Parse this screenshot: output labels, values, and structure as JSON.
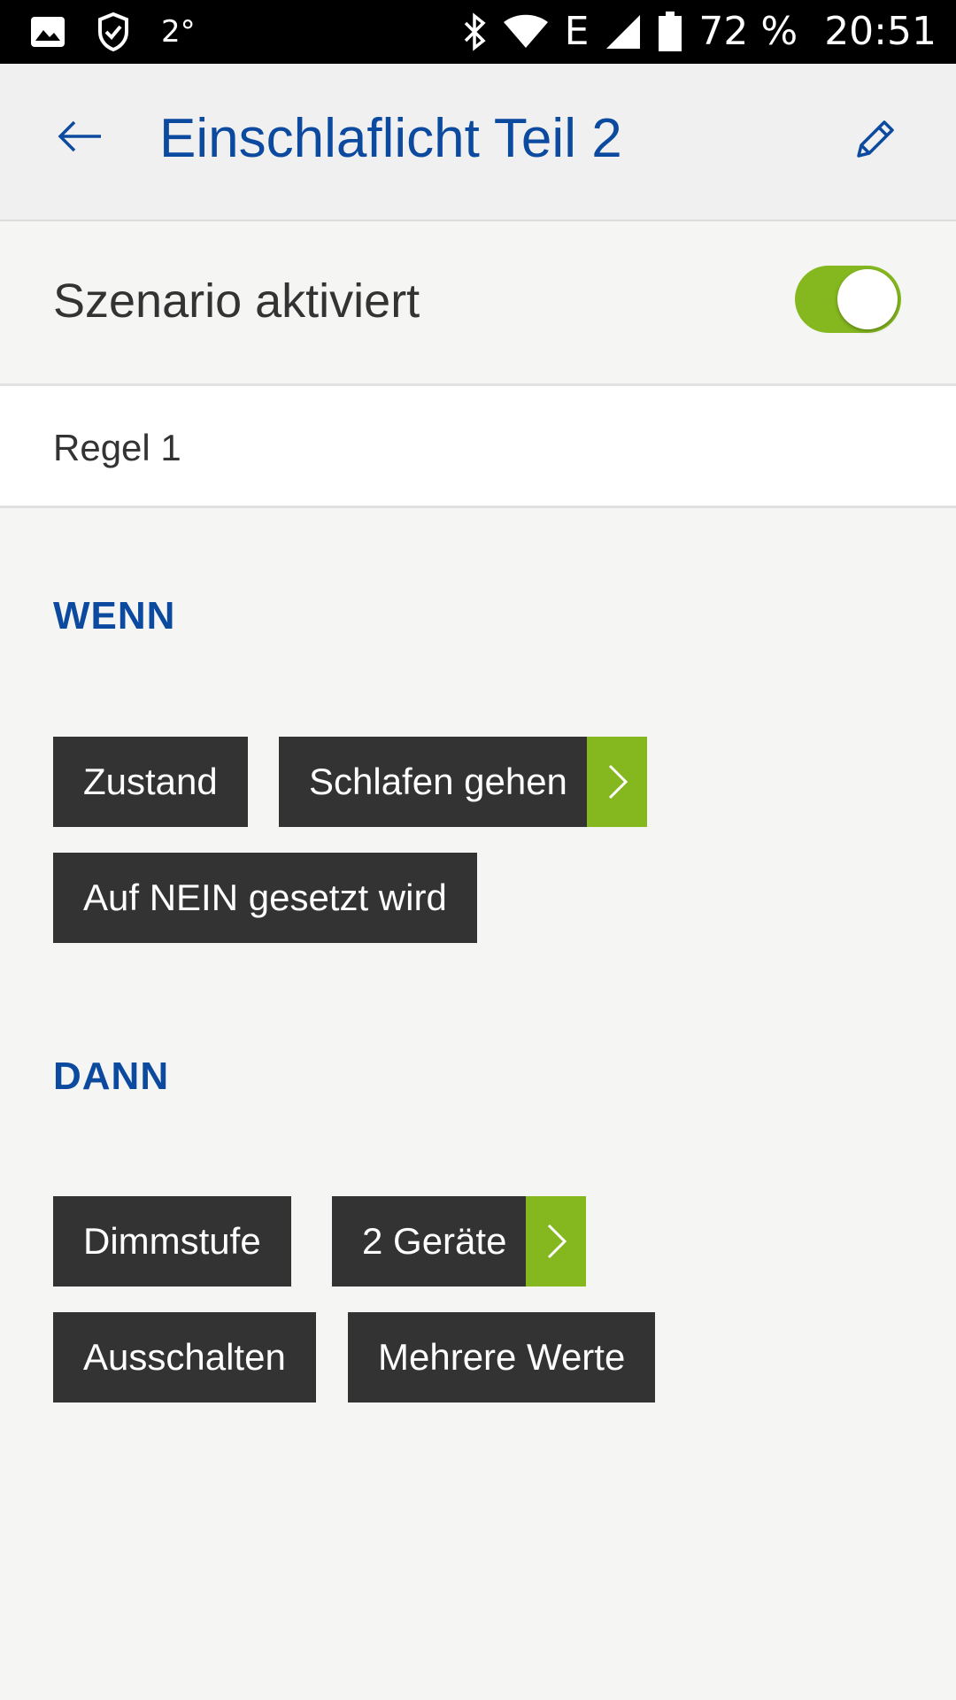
{
  "status_bar": {
    "temperature": "2°",
    "network_type": "E",
    "battery": "72 %",
    "time": "20:51",
    "icons": [
      "image-icon",
      "shield-check-icon",
      "bluetooth-icon",
      "wifi-icon",
      "signal-icon",
      "battery-icon"
    ]
  },
  "header": {
    "title": "Einschlaflicht Teil 2",
    "back_icon": "arrow-left-icon",
    "edit_icon": "pencil-icon"
  },
  "scenario": {
    "label": "Szenario aktiviert",
    "enabled": true
  },
  "rule": {
    "label": "Regel 1"
  },
  "when": {
    "heading": "WENN",
    "chips": [
      "Zustand",
      "Schlafen gehen",
      "Auf NEIN gesetzt wird"
    ]
  },
  "then": {
    "heading": "DANN",
    "chips": [
      "Dimmstufe",
      "2 Geräte",
      "Ausschalten",
      "Mehrere Werte"
    ]
  },
  "colors": {
    "accent_blue": "#0c4aa0",
    "accent_green": "#85b81f",
    "chip_bg": "#333333",
    "background": "#f5f5f4"
  }
}
